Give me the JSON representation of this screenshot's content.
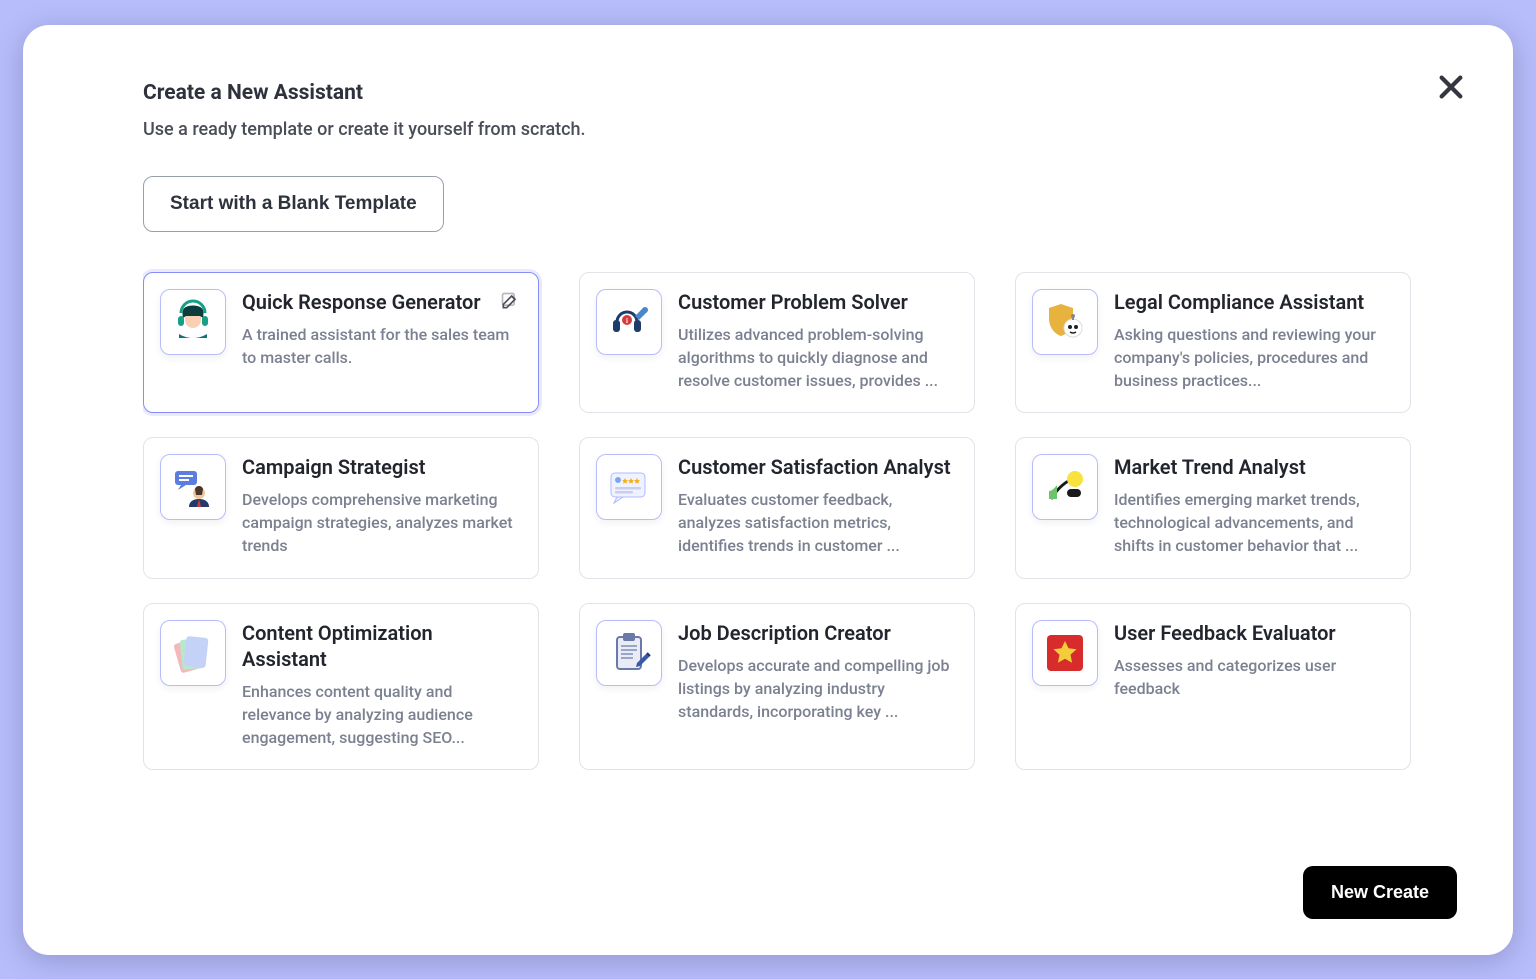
{
  "modal": {
    "title": "Create a New Assistant",
    "subtitle": "Use a ready template or create it yourself from scratch.",
    "blank_button": "Start with a Blank Template",
    "create_button": "New Create"
  },
  "templates": [
    {
      "title": "Quick Response Generator",
      "description": "A trained assistant for the sales team to master calls.",
      "icon": "avatar-headset",
      "selected": true,
      "editable": true
    },
    {
      "title": "Customer Problem Solver",
      "description": "Utilizes advanced problem-solving algorithms to quickly diagnose and resolve customer issues, provides ...",
      "icon": "headphones-wrench",
      "selected": false,
      "editable": false
    },
    {
      "title": "Legal Compliance Assistant",
      "description": "Asking questions and reviewing your company's policies, procedures and business practices...",
      "icon": "shield-bot",
      "selected": false,
      "editable": false
    },
    {
      "title": "Campaign Strategist",
      "description": "Develops comprehensive marketing campaign strategies, analyzes market trends",
      "icon": "businessman-chat",
      "selected": false,
      "editable": false
    },
    {
      "title": "Customer Satisfaction Analyst",
      "description": "Evaluates customer feedback, analyzes satisfaction metrics, identifies trends in customer ...",
      "icon": "review-stars",
      "selected": false,
      "editable": false
    },
    {
      "title": "Market Trend Analyst",
      "description": "Identifies emerging market trends, technological advancements, and shifts in customer behavior that ...",
      "icon": "trend-shapes",
      "selected": false,
      "editable": false
    },
    {
      "title": "Content Optimization Assistant",
      "description": "Enhances content quality and relevance by analyzing audience engagement, suggesting SEO...",
      "icon": "color-sheets",
      "selected": false,
      "editable": false
    },
    {
      "title": "Job Description Creator",
      "description": "Develops accurate and compelling job listings by analyzing industry standards, incorporating key ...",
      "icon": "clipboard-pen",
      "selected": false,
      "editable": false
    },
    {
      "title": "User Feedback Evaluator",
      "description": "Assesses and categorizes user feedback",
      "icon": "red-star",
      "selected": false,
      "editable": false
    }
  ]
}
